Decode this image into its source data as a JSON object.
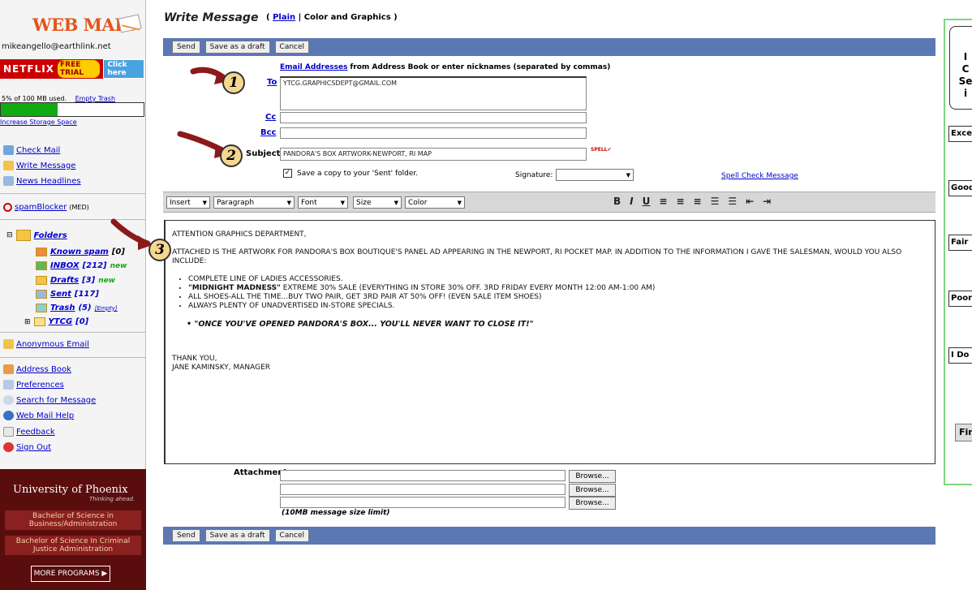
{
  "sidebar": {
    "logo": "WEB MAIL",
    "email": "mikeangello@earthlink.net",
    "netflix": {
      "brand": "NETFLIX",
      "free": "FREE TRIAL",
      "cta": "Click here"
    },
    "storage": {
      "used_text": "5% of 100 MB used.",
      "empty_trash": "Empty Trash",
      "increase": "Increase Storage Space",
      "fraction": 0.05
    },
    "nav_top": [
      {
        "label": "Check Mail",
        "icon": "check-mail-icon"
      },
      {
        "label": "Write Message",
        "icon": "write-message-icon"
      },
      {
        "label": "News Headlines",
        "icon": "news-icon"
      }
    ],
    "spam": {
      "label": "spamBlocker",
      "level": "(MED)"
    },
    "folders": {
      "title": "Folders",
      "items": [
        {
          "name": "Known spam",
          "count": "[0]"
        },
        {
          "name": "INBOX",
          "count": "[212]",
          "badge": "new"
        },
        {
          "name": "Drafts",
          "count": "[3]",
          "badge": "new"
        },
        {
          "name": "Sent",
          "count": "[117]"
        },
        {
          "name": "Trash",
          "count": "(5)",
          "extra": "[Empty]"
        },
        {
          "name": "YTCG",
          "count": "[0]"
        }
      ]
    },
    "anon": "Anonymous Email",
    "nav_bottom": [
      "Address Book",
      "Preferences",
      "Search for Message",
      "Web Mail Help",
      "Feedback",
      "Sign Out"
    ],
    "ad": {
      "brand": "University of Phoenix",
      "tagline": "Thinking ahead.",
      "programs": [
        "Bachelor of Science in Business/Administration",
        "Bachelor of Science In Criminal Justice Administration"
      ],
      "more": "MORE PROGRAMS ▶"
    }
  },
  "compose": {
    "title": "Write Message",
    "mode_plain": "Plain",
    "mode_color": "Color and Graphics",
    "buttons": {
      "send": "Send",
      "draft": "Save as a draft",
      "cancel": "Cancel"
    },
    "address_hint_link": "Email Addresses",
    "address_hint_rest": "from Address Book or enter nicknames (separated by commas)",
    "labels": {
      "to": "To",
      "cc": "Cc",
      "bcc": "Bcc",
      "subject": "Subject",
      "signature": "Signature:",
      "attachment": "Attachment"
    },
    "to": "YTCG.GRAPHICSDEPT@GMAIL.COM",
    "cc": "",
    "bcc": "",
    "subject": "PANDORA'S BOX ARTWORK-NEWPORT, RI MAP",
    "save_copy": "Save a copy to your 'Sent' folder.",
    "spell_check": "Spell Check Message",
    "format": {
      "insert": "Insert",
      "paragraph": "Paragraph",
      "font": "Font",
      "size": "Size",
      "color": "Color"
    },
    "body": {
      "greeting": "ATTENTION GRAPHICS DEPARTMENT,",
      "para": "ATTACHED IS THE ARTWORK FOR PANDORA'S BOX BOUTIQUE'S PANEL AD APPEARING IN THE NEWPORT, RI POCKET MAP.  IN ADDITION TO THE INFORMATION I GAVE THE SALESMAN, WOULD YOU ALSO INCLUDE:",
      "bullet1": "COMPLETE LINE OF LADIES ACCESSORIES.",
      "bullet2_bold": "\"MIDNIGHT MADNESS\"",
      "bullet2_rest": " EXTREME 30% SALE (EVERYTHING IN STORE 30% OFF.  3RD FRIDAY EVERY MONTH 12:00 AM-1:00 AM)",
      "bullet3": "ALL SHOES-ALL THE TIME...BUY TWO PAIR, GET 3RD PAIR AT 50% OFF! (EVEN SALE ITEM SHOES)",
      "bullet4": "ALWAYS PLENTY OF UNADVERTISED IN-STORE SPECIALS.",
      "slogan": "• \"ONCE YOU'VE OPENED PANDORA'S BOX... YOU'LL NEVER WANT TO CLOSE IT!\"",
      "closing": "THANK YOU,",
      "signature": "JANE KAMINSKY, MANAGER"
    },
    "browse": "Browse...",
    "size_limit": "(10MB message size limit)"
  },
  "callouts": [
    "1",
    "2",
    "3"
  ],
  "right_panel": {
    "box": [
      "I",
      "C",
      "Se",
      "i"
    ],
    "options": [
      "Exce",
      "Good",
      "Fair",
      "Poor",
      "I Do"
    ],
    "finish": "Fin"
  },
  "colors": {
    "toolbar": "#5b78b5",
    "accent_orange": "#e2551a",
    "panel_border": "#7cd87c",
    "ad_bg": "#5a0d0d"
  }
}
